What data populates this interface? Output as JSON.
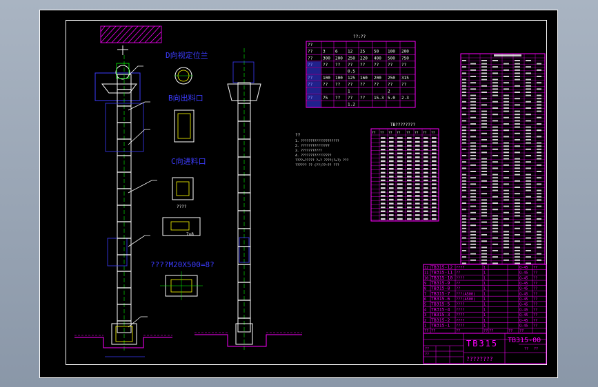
{
  "colors": {
    "frame": "#ffffff",
    "background": "#000000",
    "magenta": "#ff00ff",
    "white": "#ffffff",
    "green": "#00ff00",
    "yellow": "#ffff00",
    "blue": "#3c3cff",
    "cyan": "#00ffff",
    "red": "#ff2020"
  },
  "views": {
    "label_d": "D向视定位兰",
    "label_b": "B向出料口",
    "label_c": "C向进料口",
    "label_small": "????",
    "label_dim": "7×8",
    "label_bolt": "????M20X500=8?"
  },
  "param_table": {
    "title": "??:??",
    "rows": [
      [
        "??",
        "",
        "",
        "",
        "",
        "",
        ""
      ],
      [
        "??",
        "3",
        "6",
        "12",
        "25",
        "50",
        "100",
        "200"
      ],
      [
        "??",
        "300",
        "200",
        "250",
        "220",
        "400",
        "500",
        "750"
      ],
      [
        "??",
        "??",
        "??",
        "??",
        "??",
        "??",
        "??",
        "??"
      ],
      [
        "",
        "",
        "",
        "0.5",
        "",
        "",
        "",
        ""
      ],
      [
        "??",
        "100",
        "100",
        "125",
        "160",
        "200",
        "250",
        "315"
      ],
      [
        "??",
        "??",
        "??",
        "??",
        "??",
        "??",
        "??",
        "??"
      ],
      [
        "",
        "",
        "",
        "1",
        "",
        "",
        "2",
        ""
      ],
      [
        "??",
        "75",
        "??",
        "??",
        "??",
        "15.3",
        "5.0",
        "2.3"
      ],
      [
        "",
        "",
        "",
        "1.2",
        "",
        "",
        "",
        ""
      ]
    ]
  },
  "notes": {
    "title": "??",
    "lines": [
      "1. ????????????????????",
      "2. ???????????????",
      "3. ???????????",
      "4. ????????????????",
      "   ????=????? ?=?  ????(?=?)  ???",
      "   ?????? ?? (??)??~??  ???"
    ]
  },
  "spec_table": {
    "title": "TB????????",
    "header": [
      "??",
      "??",
      "??",
      "??",
      "??",
      "??",
      "??",
      "??"
    ]
  },
  "parts_list": {
    "rows": [
      [
        "12",
        "TB315-12",
        "????",
        "1",
        "",
        "",
        "Q-45",
        "??"
      ],
      [
        "11",
        "TB315-11",
        "??",
        "1",
        "",
        "",
        "Q-45",
        "??"
      ],
      [
        "10",
        "TB315-10",
        "????",
        "1",
        "",
        "",
        "Q-45",
        "??"
      ],
      [
        "9",
        "TB315-9",
        "??",
        "1",
        "",
        "",
        "Q-45",
        "??"
      ],
      [
        "8",
        "TB315-8",
        "??",
        "1",
        "",
        "",
        "Q-45",
        "??"
      ],
      [
        "7",
        "TB315-7",
        "???(A500)",
        "1",
        "",
        "",
        "Q-45",
        "??"
      ],
      [
        "6",
        "TB315-6",
        "???(A500)",
        "1",
        "",
        "",
        "Q-45",
        "??"
      ],
      [
        "5",
        "TB315-5",
        "????",
        "1",
        "",
        "",
        "Q-45",
        "??"
      ],
      [
        "4",
        "TB315-4",
        "????",
        "1",
        "",
        "",
        "Q-45",
        "??"
      ],
      [
        "3",
        "TB315-3",
        "????",
        "1",
        "",
        "",
        "Q-45",
        "??"
      ],
      [
        "2",
        "TB315-2",
        "????",
        "1",
        "",
        "",
        "Q-45",
        "??"
      ],
      [
        "1",
        "TB315-1",
        "????",
        "1",
        "",
        "",
        "Q-45",
        "??"
      ]
    ],
    "header": [
      "??",
      "??",
      "??",
      "??",
      "??",
      "??",
      "??"
    ]
  },
  "title_block": {
    "model": "TB315",
    "drawing_no": "TB315-00",
    "company": "????????",
    "small": [
      "??",
      "??",
      "??",
      "??"
    ]
  }
}
